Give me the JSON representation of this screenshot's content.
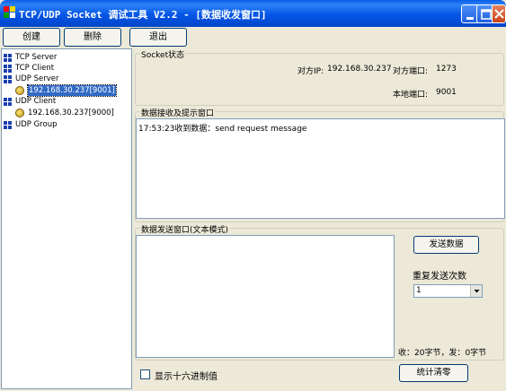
{
  "window": {
    "title": "TCP/UDP Socket 调试工具 V2.2 - [数据收发窗口]"
  },
  "toolbar": {
    "create_label": "创建",
    "delete_label": "删除",
    "exit_label": "退出"
  },
  "tree": {
    "items": [
      {
        "label": "TCP Server"
      },
      {
        "label": "TCP Client"
      },
      {
        "label": "UDP Server"
      },
      {
        "label": "192.168.30.237[9001]"
      },
      {
        "label": "UDP Client"
      },
      {
        "label": "192.168.30.237[9000]"
      },
      {
        "label": "UDP Group"
      }
    ]
  },
  "socket_status": {
    "legend": "Socket状态",
    "peer_ip_label": "对方IP:",
    "peer_ip_value": "192.168.30.237",
    "peer_port_label": "对方端口:",
    "peer_port_value": "1273",
    "local_port_label": "本地端口:",
    "local_port_value": "9001"
  },
  "receive": {
    "legend": "数据接收及提示窗口",
    "log_line": "17:53:23收到数据：send request message"
  },
  "send": {
    "legend": "数据发送窗口(文本模式)",
    "send_button": "发送数据",
    "repeat_label": "重复发送次数",
    "repeat_value": "1",
    "stats_text": "收：20字节，发：0字节"
  },
  "footer": {
    "hex_checkbox_label": "显示十六进制值",
    "clear_stats_button": "统计清零"
  },
  "colors": {
    "title_bar": "#0555e6",
    "selection": "#316ac5",
    "window_bg": "#ece9d8"
  }
}
